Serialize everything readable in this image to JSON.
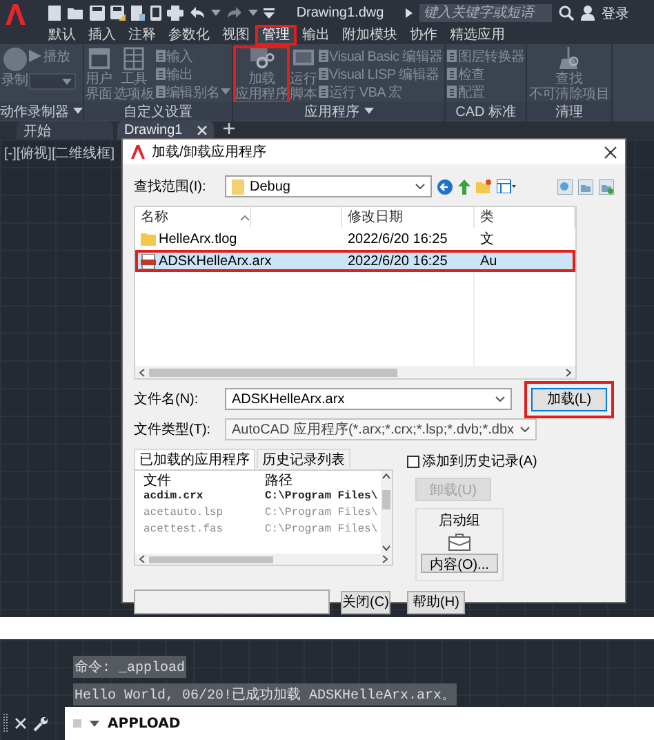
{
  "title_bar": {
    "document_title": "Drawing1.dwg",
    "search": {
      "placeholder": "键入关键字或短语"
    },
    "sign_in": "登录"
  },
  "ribbon_tabs": [
    {
      "label": "默认",
      "selected": false,
      "highlighted": false
    },
    {
      "label": "插入",
      "selected": false,
      "highlighted": false
    },
    {
      "label": "注释",
      "selected": false,
      "highlighted": false
    },
    {
      "label": "参数化",
      "selected": false,
      "highlighted": false
    },
    {
      "label": "视图",
      "selected": false,
      "highlighted": false
    },
    {
      "label": "管理",
      "selected": true,
      "highlighted": true
    },
    {
      "label": "输出",
      "selected": false,
      "highlighted": false
    },
    {
      "label": "附加模块",
      "selected": false,
      "highlighted": false
    },
    {
      "label": "协作",
      "selected": false,
      "highlighted": false
    },
    {
      "label": "精选应用",
      "selected": false,
      "highlighted": false
    }
  ],
  "ribbon_panels": [
    {
      "title": "动作录制器",
      "dropdown": true,
      "items": [
        {
          "kind": "big",
          "lines": [
            "录制"
          ],
          "highlighted": false
        },
        {
          "kind": "stack",
          "items": [
            {
              "kind": "small",
              "label": "播放",
              "dropdown": false
            },
            {
              "kind": "combo"
            }
          ]
        }
      ]
    },
    {
      "title": "自定义设置",
      "dropdown": false,
      "items": [
        {
          "kind": "big",
          "lines": [
            "用户",
            "界面"
          ],
          "highlighted": false
        },
        {
          "kind": "big",
          "lines": [
            "工具",
            "选项板"
          ],
          "highlighted": false
        },
        {
          "kind": "stack",
          "items": [
            {
              "kind": "small",
              "label": "输入",
              "dropdown": false
            },
            {
              "kind": "small",
              "label": "输出",
              "dropdown": false
            },
            {
              "kind": "small",
              "label": "编辑别名",
              "dropdown": true
            }
          ]
        }
      ]
    },
    {
      "title": "应用程序",
      "dropdown": true,
      "items": [
        {
          "kind": "big",
          "lines": [
            "加载",
            "应用程序"
          ],
          "highlighted": true
        },
        {
          "kind": "big",
          "lines": [
            "运行",
            "脚本"
          ],
          "highlighted": false
        },
        {
          "kind": "stack",
          "items": [
            {
              "kind": "small",
              "label": "Visual Basic 编辑器",
              "dropdown": false
            },
            {
              "kind": "small",
              "label": "Visual LISP 编辑器",
              "dropdown": false
            },
            {
              "kind": "small",
              "label": "运行 VBA 宏",
              "dropdown": false
            }
          ]
        }
      ]
    },
    {
      "title": "CAD 标准",
      "dropdown": false,
      "items": [
        {
          "kind": "stack",
          "items": [
            {
              "kind": "small",
              "label": "图层转换器",
              "dropdown": false
            },
            {
              "kind": "small",
              "label": "检查",
              "dropdown": false
            },
            {
              "kind": "small",
              "label": "配置",
              "dropdown": false
            }
          ]
        }
      ]
    },
    {
      "title": "清理",
      "dropdown": false,
      "items": [
        {
          "kind": "big",
          "lines": [
            "查找",
            "不可清除项目"
          ],
          "highlighted": false
        }
      ]
    }
  ],
  "document_tabs": [
    {
      "label": "开始",
      "selected": false,
      "closable": false
    },
    {
      "label": "Drawing1",
      "selected": true,
      "closable": true
    }
  ],
  "viewport_label": "[-][俯视][二维线框]",
  "dialog": {
    "title": "加载/卸载应用程序",
    "look_in": {
      "label": "查找范围(I):",
      "value": "Debug"
    },
    "file_list": {
      "columns": [
        "名称",
        "修改日期",
        "类"
      ],
      "rows": [
        {
          "kind": "folder",
          "name": "HelleArx.tlog",
          "modified": "2022/6/20 16:25",
          "type": "文",
          "selected": false,
          "highlighted": false
        },
        {
          "kind": "arx",
          "name": "ADSKHelleArx.arx",
          "modified": "2022/6/20 16:25",
          "type": "Au",
          "selected": true,
          "highlighted": true
        }
      ]
    },
    "file_name": {
      "label": "文件名(N):",
      "value": "ADSKHelleArx.arx"
    },
    "load_button": {
      "label": "加载(L)",
      "highlighted": true
    },
    "file_type": {
      "label": "文件类型(T):",
      "value": "AutoCAD 应用程序(*.arx;*.crx;*.lsp;*.dvb;*.dbx"
    },
    "tabs": [
      {
        "label": "已加载的应用程序",
        "selected": true
      },
      {
        "label": "历史记录列表",
        "selected": false
      }
    ],
    "loaded_apps": {
      "columns": [
        "文件",
        "路径"
      ],
      "rows": [
        {
          "file": "acdim.crx",
          "path": "C:\\Program Files\\",
          "dimmed": false
        },
        {
          "file": "acetauto.lsp",
          "path": "C:\\Program Files\\",
          "dimmed": true
        },
        {
          "file": "acettest.fas",
          "path": "C:\\Program Files\\",
          "dimmed": true
        }
      ]
    },
    "add_to_history": {
      "label": "添加到历史记录(A)",
      "checked": false
    },
    "unload_button": {
      "label": "卸载(U)",
      "disabled": true
    },
    "startup_suite": {
      "title": "启动组",
      "button": "内容(O)..."
    },
    "buttons": [
      {
        "label": "关闭(C)"
      },
      {
        "label": "帮助(H)"
      }
    ]
  },
  "command": {
    "history": [
      "命令: _appload",
      "Hello World, 06/20!已成功加载 ADSKHelleArx.arx。"
    ],
    "input": {
      "value": "APPLOAD"
    }
  }
}
